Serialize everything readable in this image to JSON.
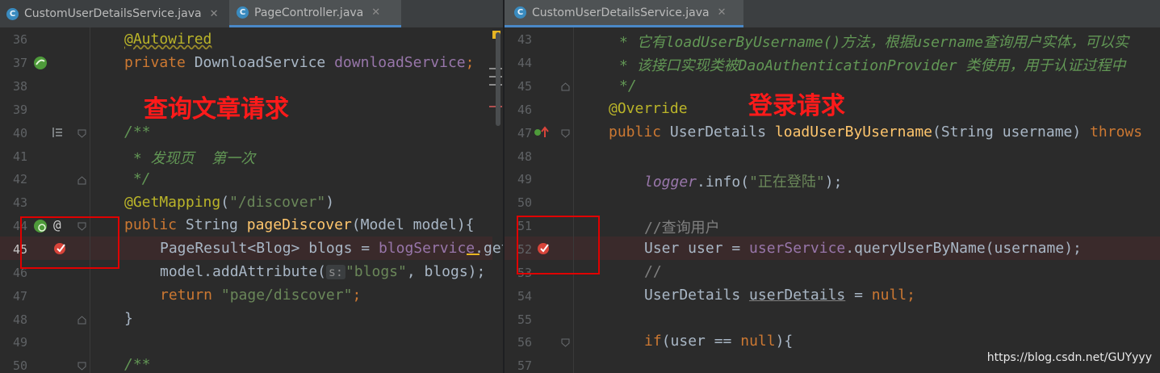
{
  "left": {
    "tabs": [
      {
        "label": "CustomUserDetailsService.java",
        "active": false
      },
      {
        "label": "PageController.java",
        "active": true
      }
    ],
    "line_numbers": [
      "36",
      "37",
      "38",
      "39",
      "40",
      "41",
      "42",
      "43",
      "44",
      "45",
      "46",
      "47",
      "48",
      "49",
      "50"
    ],
    "code": {
      "l36_ann": "@Autowired",
      "l37_kw": "private",
      "l37_type": " DownloadService ",
      "l37_field": "downloadService",
      "l37_end": ";",
      "l40": "/**",
      "l41": " * 发现页  第一次",
      "l42": " */",
      "l43_ann": "@GetMapping",
      "l43_p1": "(",
      "l43_str": "\"/discover\"",
      "l43_p2": ")",
      "l44_kw": "public",
      "l44_type": " String ",
      "l44_method": "pageDiscover",
      "l44_rest": "(Model model){",
      "l45_a": "PageResult<Blog> blogs = ",
      "l45_field": "blogService",
      "l45_b": ".getD",
      "l46_a": "model.addAttribute(",
      "l46_hint": "s:",
      "l46_str": "\"blogs\"",
      "l46_b": ", blogs);",
      "l47_kw": "return",
      "l47_str": "\"page/discover\"",
      "l47_end": ";",
      "l48": "}",
      "l50": "/**"
    },
    "annotation_label": "查询文章请求"
  },
  "right": {
    "tabs": [
      {
        "label": "CustomUserDetailsService.java",
        "active": true
      }
    ],
    "line_numbers": [
      "43",
      "44",
      "45",
      "46",
      "47",
      "48",
      "49",
      "50",
      "51",
      "52",
      "53",
      "54",
      "55",
      "56",
      "57"
    ],
    "code": {
      "l43": "* 它有loadUserByUsername()方法，根据username查询用户实体，可以实",
      "l44": "* 该接口实现类被DaoAuthenticationProvider 类使用，用于认证过程中",
      "l45": "*/",
      "l46_ann": "@Override",
      "l47_kw": "public",
      "l47_type": " UserDetails ",
      "l47_method": "loadUserByUsername",
      "l47_rest": "(String username) ",
      "l47_throws": "throws",
      "l49_logger": "logger",
      "l49_a": ".info(",
      "l49_str": "\"正在登陆\"",
      "l49_b": ");",
      "l51": "//查询用户",
      "l52_a": "User user = ",
      "l52_field": "userService",
      "l52_b": ".queryUserByName(username);",
      "l53": "//",
      "l54_a": "UserDetails ",
      "l54_var": "userDetails",
      "l54_b": " = ",
      "l54_null": "null",
      "l54_end": ";",
      "l56_kw": "if",
      "l56_a": "(user == ",
      "l56_null": "null",
      "l56_b": "){"
    },
    "annotation_label": "登录请求"
  },
  "watermark": "https://blog.csdn.net/GUYyyy",
  "colors": {
    "background": "#2b2b2b",
    "keyword": "#cc7832",
    "string": "#6a8759",
    "annotation": "#bbb529",
    "field": "#9876aa",
    "doc_comment": "#629755",
    "method": "#ffc66d",
    "breakpoint_line": "#3a2a2b",
    "red_annotation": "#ff1a1a"
  }
}
